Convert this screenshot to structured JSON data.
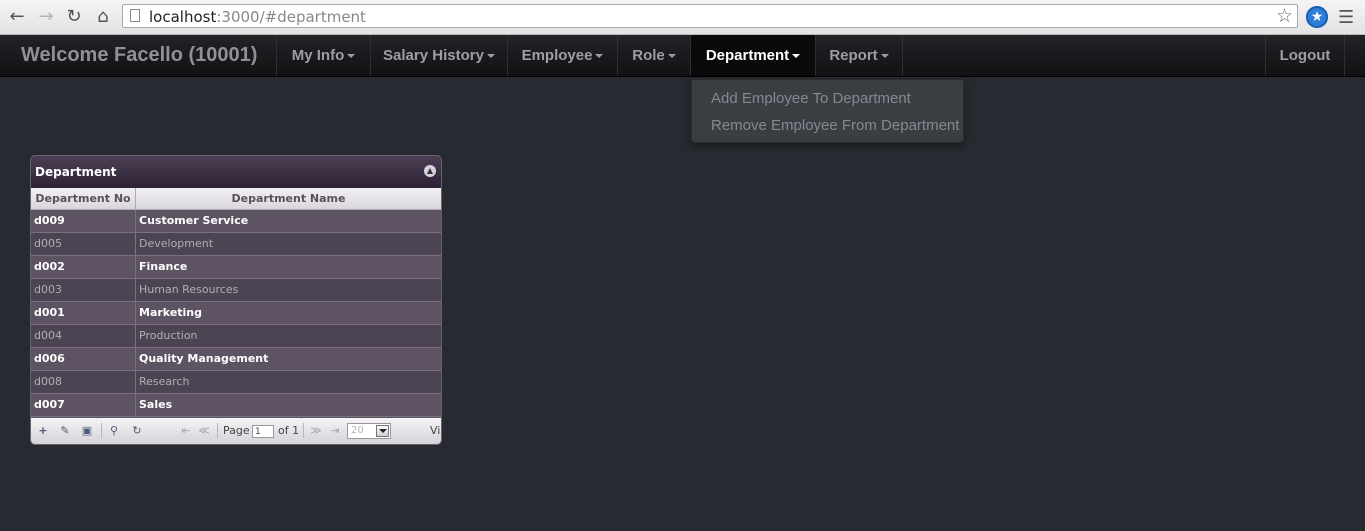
{
  "browser": {
    "url_host": "localhost",
    "url_rest": ":3000/#department"
  },
  "navbar": {
    "brand": "Welcome Facello (10001)",
    "items": [
      {
        "label": "My Info"
      },
      {
        "label": "Salary History"
      },
      {
        "label": "Employee"
      },
      {
        "label": "Role"
      },
      {
        "label": "Department"
      },
      {
        "label": "Report"
      }
    ],
    "logout": "Logout"
  },
  "dropdown": {
    "items": [
      {
        "label": "Add Employee To Department"
      },
      {
        "label": "Remove Employee From Department"
      }
    ]
  },
  "grid": {
    "title": "Department",
    "columns": [
      "Department No",
      "Department Name"
    ],
    "rows": [
      {
        "no": "d009",
        "name": "Customer Service"
      },
      {
        "no": "d005",
        "name": "Development"
      },
      {
        "no": "d002",
        "name": "Finance"
      },
      {
        "no": "d003",
        "name": "Human Resources"
      },
      {
        "no": "d001",
        "name": "Marketing"
      },
      {
        "no": "d004",
        "name": "Production"
      },
      {
        "no": "d006",
        "name": "Quality Management"
      },
      {
        "no": "d008",
        "name": "Research"
      },
      {
        "no": "d007",
        "name": "Sales"
      }
    ],
    "pager": {
      "page_label": "Page",
      "page_value": "1",
      "of_label": "of 1",
      "rows_per_page": "20",
      "view_text": "Vi"
    }
  },
  "colors": {
    "background": "#272a30",
    "navbar_active": "#0a0a0b",
    "grid_title": "#2d2335",
    "row_odd": "#5d5363",
    "row_even": "#4c4452"
  }
}
